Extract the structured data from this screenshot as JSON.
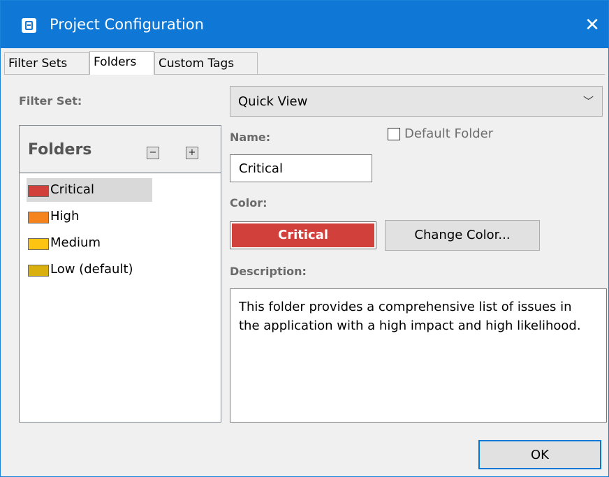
{
  "window": {
    "title": "Project Configuration",
    "close_glyph": "✕",
    "app_icon": "project-icon"
  },
  "tabs": [
    {
      "label": "Filter Sets",
      "active": false
    },
    {
      "label": "Folders",
      "active": true
    },
    {
      "label": "Custom Tags",
      "active": false
    }
  ],
  "filter_set": {
    "label": "Filter Set:",
    "value": "Quick View",
    "chevron": "﹀"
  },
  "folders_panel": {
    "title": "Folders",
    "remove_glyph": "−",
    "add_glyph": "+",
    "items": [
      {
        "label": "Critical",
        "color": "#d1403b",
        "selected": true
      },
      {
        "label": "High",
        "color": "#f5841f",
        "selected": false
      },
      {
        "label": "Medium",
        "color": "#fdc512",
        "selected": false
      },
      {
        "label": "Low (default)",
        "color": "#d9b00d",
        "selected": false
      }
    ]
  },
  "details": {
    "name_label": "Name:",
    "name_value": "Critical",
    "default_folder_label": "Default Folder",
    "default_folder_checked": false,
    "color_label": "Color:",
    "color_value_text": "Critical",
    "color_value": "#d1403b",
    "change_color_label": "Change Color...",
    "description_label": "Description:",
    "description_value": "This folder provides a comprehensive list of issues in the application with a high impact and high likelihood."
  },
  "footer": {
    "ok_label": "OK"
  },
  "colors": {
    "titlebar": "#0f78d7",
    "accent": "#0078d7"
  }
}
